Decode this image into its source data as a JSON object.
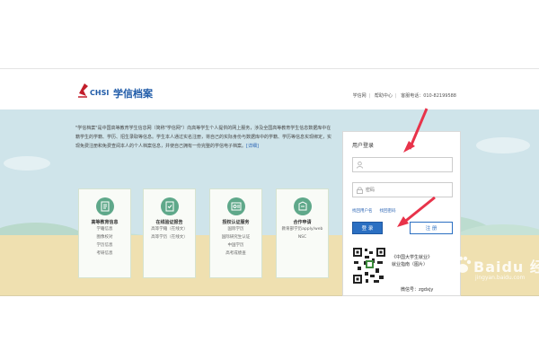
{
  "header": {
    "brand_code": "CHSI",
    "site_name": "学信档案",
    "links": [
      "学信网",
      "帮助中心",
      "客服电话：010-82199588"
    ]
  },
  "intro": {
    "text": "\"学信档案\"是中国高等教育学生信息网（简称\"学信网\"）向高等学生个人提供的网上服务，涉及全国高等教育学生信息数据库中在籍学生的学籍、学历、招生录取等信息。学生本人通过实名注册，将自己的实际身份与数据库中的学籍、学历等信息实现绑定，实现免费注册和免费查阅本人的个人档案信息，并使自己拥有一份完整的学信电子档案。",
    "more": "[详细]"
  },
  "cards": [
    {
      "title": "高等教育信息",
      "icon": "document-icon",
      "items": [
        "学籍信息",
        "图像校对",
        "学历信息",
        "考研信息"
      ]
    },
    {
      "title": "在线验证报告",
      "icon": "verify-report-icon",
      "items": [
        "高等学籍（在线文）",
        "高等学历（在线文）"
      ]
    },
    {
      "title": "授权认证服务",
      "icon": "authorization-icon",
      "items": [
        "国际学历",
        "国际研究生认证",
        "中国学历",
        "高考成绩查"
      ]
    },
    {
      "title": "合作申请",
      "icon": "application-icon",
      "items": [
        "教育部学历apply/web",
        "NSC"
      ]
    }
  ],
  "login": {
    "title": "用户登录",
    "username_placeholder": "",
    "password_placeholder": "密码",
    "find_username": "找回用户名",
    "find_password": "找回密码",
    "login_button": "登 录",
    "register_button": "注 册",
    "promo_line1": "《中国大学生就业》",
    "promo_line2": "就业指南（图片）",
    "wechat": "微信号：zgdxjy"
  },
  "watermark": {
    "text": "Baidu 经验",
    "sub": "jingyan.baidu.com"
  },
  "colors": {
    "accent": "#2b6fc2",
    "arrow": "#e8334a",
    "hero_bg": "#cfe4ea"
  }
}
